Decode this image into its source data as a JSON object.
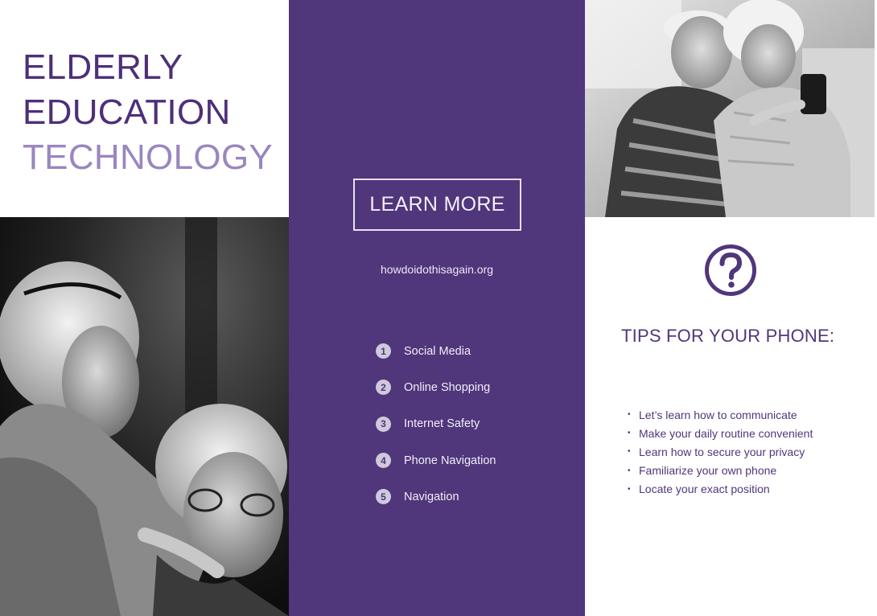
{
  "title": {
    "line1": "ELDERLY",
    "line2": "EDUCATION",
    "line3": "TECHNOLOGY"
  },
  "middle": {
    "button_label": "LEARN MORE",
    "url": "howdoidothisagain.org",
    "topics": [
      {
        "num": "1",
        "label": "Social Media"
      },
      {
        "num": "2",
        "label": "Online Shopping"
      },
      {
        "num": "3",
        "label": "Internet Safety"
      },
      {
        "num": "4",
        "label": "Phone Navigation"
      },
      {
        "num": "5",
        "label": "Navigation"
      }
    ]
  },
  "right": {
    "icon": "question-circle-icon",
    "tips_title": "TIPS FOR YOUR PHONE:",
    "bullet": "•",
    "tips": [
      "Let’s learn how to communicate",
      "Make your daily routine convenient",
      "Learn how to secure your privacy",
      "Familiarize your own phone",
      "Locate your exact position"
    ]
  },
  "colors": {
    "purple_dark": "#50367b",
    "purple_light": "#9a86bf",
    "white": "#ffffff"
  }
}
